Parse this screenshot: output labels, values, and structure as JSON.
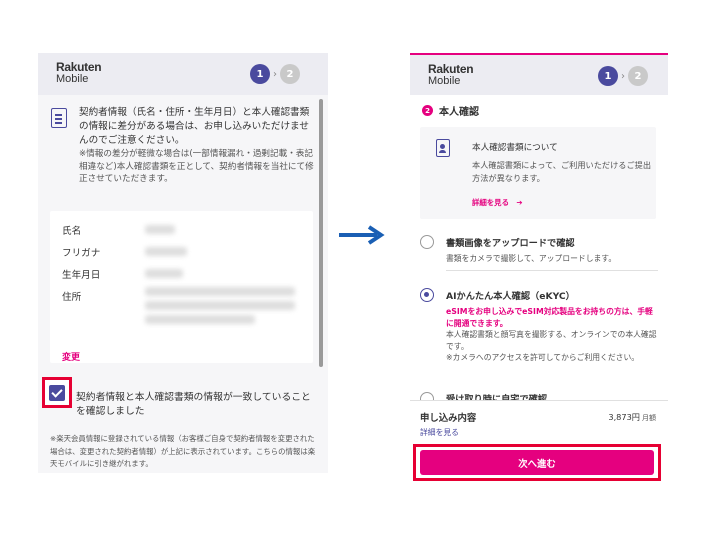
{
  "left": {
    "logo": {
      "line1": "Rakuten",
      "line2": "Mobile"
    },
    "steps": {
      "current": "1",
      "next": "2",
      "separator": "›"
    },
    "warning": "契約者情報（氏名・住所・生年月日）と本人確認書類の情報に差分がある場合は、お申し込みいただけませんのでご注意ください。",
    "warning_note": "※情報の差分が軽微な場合は(一部情報漏れ・過剰記載・表記相違など)本人確認書類を正として、契約者情報を当社にて修正させていただきます。",
    "info": {
      "labels": [
        "氏名",
        "フリガナ",
        "生年月日",
        "住所"
      ],
      "change_link": "変更"
    },
    "confirm_text": "契約者情報と本人確認書類の情報が一致していることを確認しました",
    "footnote": "※楽天会員情報に登録されている情報（お客様ご自身で契約者情報を変更された場合は、変更された契約者情報）が上記に表示されています。こちらの情報は楽天モバイルに引き継がれます。"
  },
  "right": {
    "logo": {
      "line1": "Rakuten",
      "line2": "Mobile"
    },
    "steps": {
      "current": "1",
      "next": "2",
      "separator": "›"
    },
    "section_number": "2",
    "section_title": "本人確認",
    "id_card": {
      "title": "本人確認書類について",
      "desc": "本人確認書類によって、ご利用いただけるご提出方法が異なります。",
      "link": "詳細を見る　➔"
    },
    "options": [
      {
        "title": "書類画像をアップロードで確認",
        "desc": "書類をカメラで撮影して、アップロードします。",
        "selected": false
      },
      {
        "title": "AIかんたん本人確認（eKYC）",
        "notice": "eSIMをお申し込みでeSIM対応製品をお持ちの方は、手軽に開通できます。",
        "desc": "本人確認書類と顔写真を撮影する、オンラインでの本人確認です。\n※カメラへのアクセスを許可してからご利用ください。",
        "selected": true
      }
    ],
    "cut_option_title": "受け取り時に自宅で確認",
    "summary": {
      "title": "申し込み内容",
      "price": "3,873円",
      "unit": "月額",
      "detail_link": "詳細を見る"
    },
    "next_button": "次へ進む"
  },
  "colors": {
    "brand_pink": "#e5007f",
    "indigo": "#4a4a9e",
    "highlight_red": "#e60033",
    "arrow_blue": "#1a5fb4"
  }
}
